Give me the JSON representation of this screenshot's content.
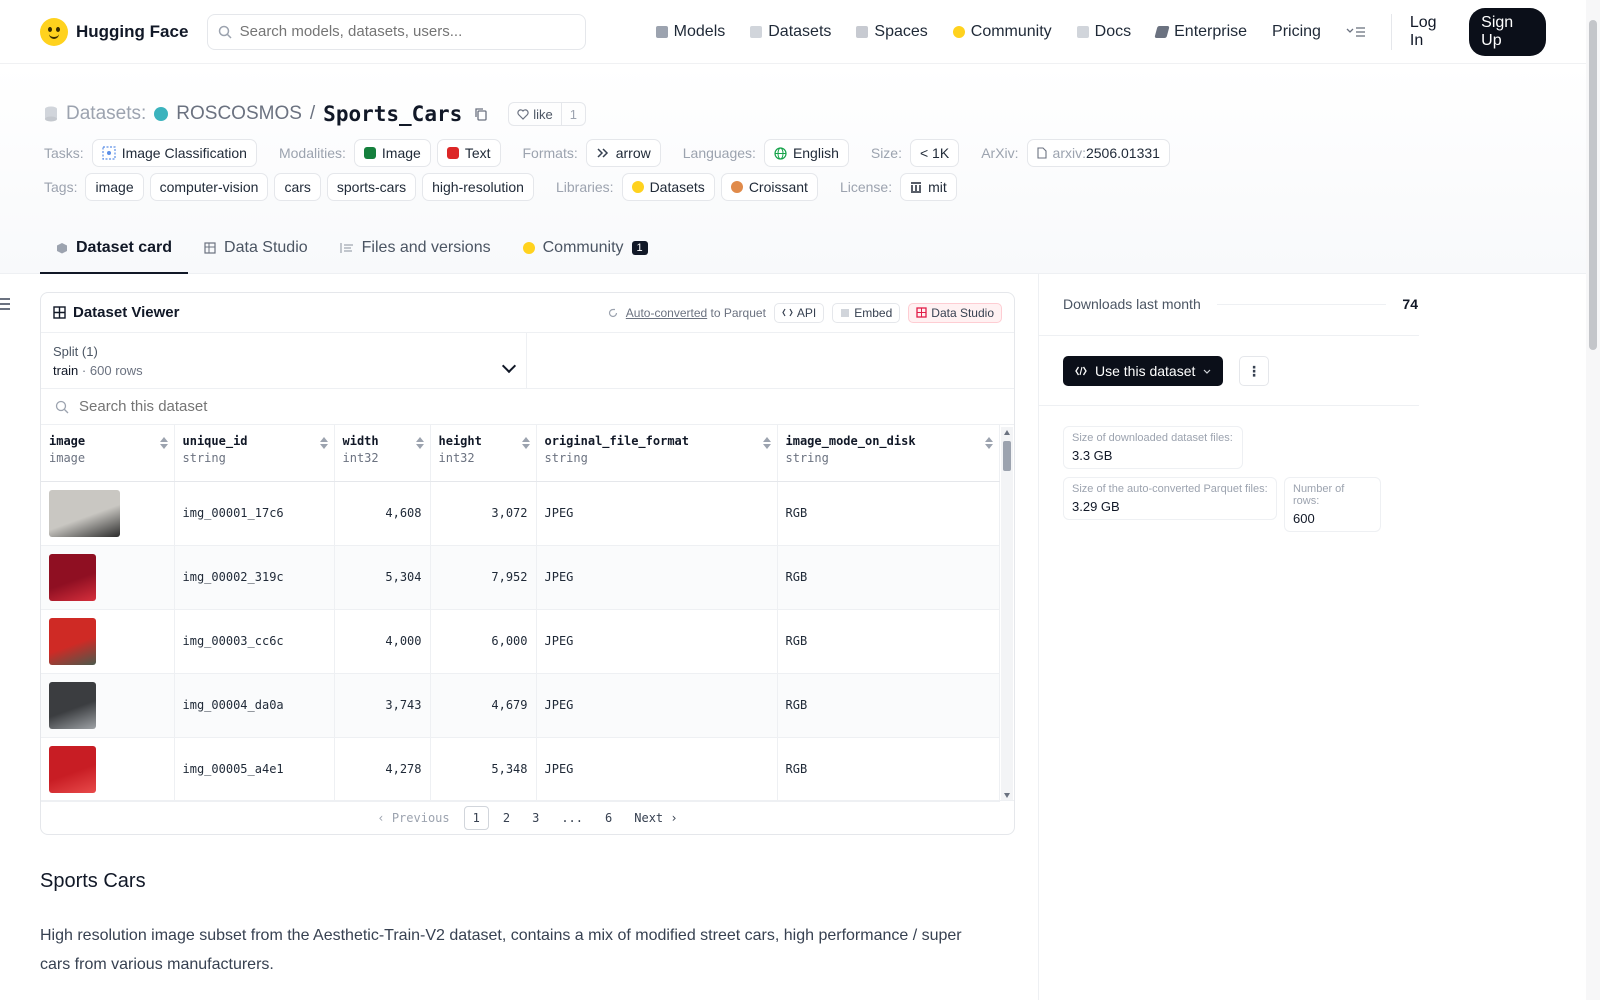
{
  "nav": {
    "brand": "Hugging Face",
    "search_placeholder": "Search models, datasets, users...",
    "links": [
      {
        "label": "Models",
        "color": "#9ca3af"
      },
      {
        "label": "Datasets",
        "color": "#d1d5db"
      },
      {
        "label": "Spaces",
        "color": "#c7cad1"
      },
      {
        "label": "Community",
        "color": "#ffd21e"
      },
      {
        "label": "Docs",
        "color": "#d1d5db"
      },
      {
        "label": "Enterprise",
        "color": "#6b7280"
      },
      {
        "label": "Pricing",
        "color": ""
      }
    ],
    "login": "Log In",
    "signup": "Sign Up"
  },
  "header": {
    "crumb": "Datasets:",
    "owner": "ROSCOSMOS",
    "slash": "/",
    "name": "Sports_Cars",
    "like_label": "like",
    "like_count": "1",
    "tasks_label": "Tasks:",
    "task": "Image Classification",
    "modalities_label": "Modalities:",
    "modalities": [
      "Image",
      "Text"
    ],
    "formats_label": "Formats:",
    "format": "arrow",
    "languages_label": "Languages:",
    "language": "English",
    "size_label": "Size:",
    "size": "< 1K",
    "arxiv_label": "ArXiv:",
    "arxiv_prefix": "arxiv:",
    "arxiv": "2506.01331",
    "tags_label": "Tags:",
    "tags": [
      "image",
      "computer-vision",
      "cars",
      "sports-cars",
      "high-resolution"
    ],
    "libraries_label": "Libraries:",
    "libraries": [
      "Datasets",
      "Croissant"
    ],
    "license_label": "License:",
    "license": "mit"
  },
  "tabs": [
    {
      "label": "Dataset card",
      "active": true
    },
    {
      "label": "Data Studio",
      "active": false
    },
    {
      "label": "Files and versions",
      "active": false
    },
    {
      "label": "Community",
      "active": false,
      "badge": "1"
    }
  ],
  "viewer": {
    "title": "Dataset Viewer",
    "auto_converted": "Auto-converted",
    "to_parquet": "to Parquet",
    "api": "API",
    "embed": "Embed",
    "data_studio": "Data Studio",
    "split_label": "Split (1)",
    "split_name": "train",
    "split_sep": "·",
    "split_rows": "600 rows",
    "search_placeholder": "Search this dataset",
    "columns": [
      {
        "name": "image",
        "type": "image"
      },
      {
        "name": "unique_id",
        "type": "string"
      },
      {
        "name": "width",
        "type": "int32"
      },
      {
        "name": "height",
        "type": "int32"
      },
      {
        "name": "original_file_format",
        "type": "string"
      },
      {
        "name": "image_mode_on_disk",
        "type": "string"
      }
    ],
    "rows": [
      {
        "id": "img_00001_17c6",
        "width": "4,608",
        "height": "3,072",
        "format": "JPEG",
        "mode": "RGB",
        "thumb": "#c9c7c2",
        "thumb2": "#2b2b2b",
        "wide": true
      },
      {
        "id": "img_00002_319c",
        "width": "5,304",
        "height": "7,952",
        "format": "JPEG",
        "mode": "RGB",
        "thumb": "#8f0f22",
        "thumb2": "#d62f3c",
        "wide": false
      },
      {
        "id": "img_00003_cc6c",
        "width": "4,000",
        "height": "6,000",
        "format": "JPEG",
        "mode": "RGB",
        "thumb": "#cf2a25",
        "thumb2": "#4a5a4c",
        "wide": false
      },
      {
        "id": "img_00004_da0a",
        "width": "3,743",
        "height": "4,679",
        "format": "JPEG",
        "mode": "RGB",
        "thumb": "#3b3d40",
        "thumb2": "#9ea2a6",
        "wide": false
      },
      {
        "id": "img_00005_a4e1",
        "width": "4,278",
        "height": "5,348",
        "format": "JPEG",
        "mode": "RGB",
        "thumb": "#c81d24",
        "thumb2": "#e84a4a",
        "wide": false
      }
    ],
    "pager": {
      "prev": "Previous",
      "pages": [
        "1",
        "2",
        "3",
        "...",
        "6"
      ],
      "next": "Next",
      "current": "1"
    }
  },
  "content": {
    "heading": "Sports Cars",
    "body": "High resolution image subset from the Aesthetic-Train-V2 dataset, contains a mix of modified street cars, high performance / super cars from various manufacturers."
  },
  "sidebar": {
    "downloads_label": "Downloads last month",
    "downloads_value": "74",
    "use_button": "Use this dataset",
    "more": "⋮",
    "stats": [
      {
        "label": "Size of downloaded dataset files:",
        "value": "3.3 GB"
      },
      {
        "label": "Size of the auto-converted Parquet files:",
        "value": "3.29 GB"
      },
      {
        "label": "Number of rows:",
        "value": "600"
      }
    ]
  },
  "colors": {
    "accent": "#0b0f19",
    "brand": "#ffd21e",
    "owner_dot": "#3bb3bd"
  }
}
